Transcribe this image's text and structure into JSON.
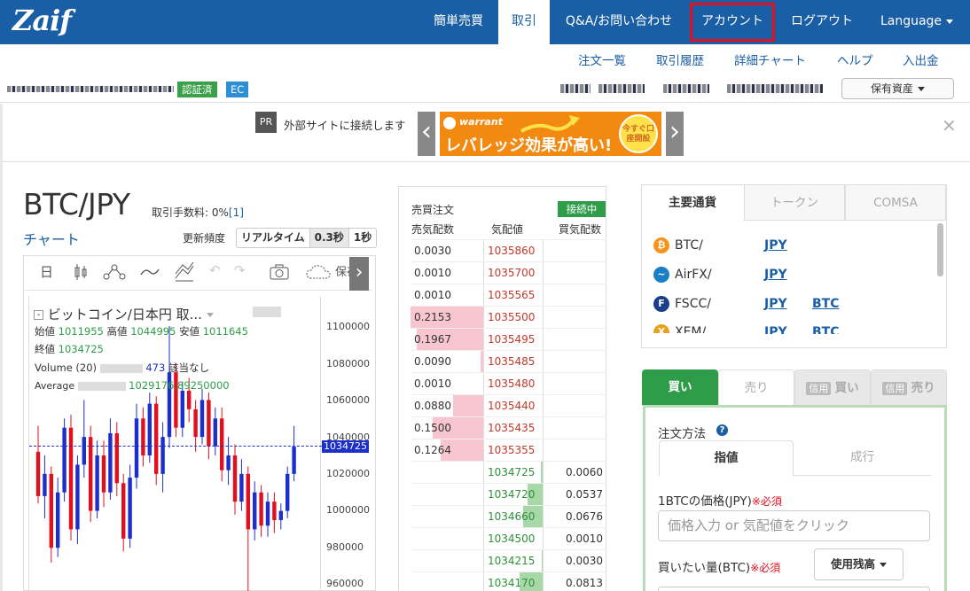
{
  "brand": {
    "logo_text": "Zaif"
  },
  "nav": {
    "items": [
      {
        "label": "簡単売買"
      },
      {
        "label": "取引"
      },
      {
        "label": "Q&A/お問い合わせ"
      },
      {
        "label": "アカウント"
      },
      {
        "label": "ログアウト"
      },
      {
        "label": "Language"
      }
    ],
    "active_index": 1,
    "highlighted_index": 3
  },
  "subnav": {
    "items": [
      "注文一覧",
      "取引履歴",
      "詳細チャート",
      "ヘルプ",
      "入出金"
    ]
  },
  "user": {
    "verified_badge": "認証済",
    "ec_badge": "EC",
    "assets_button": "保有資産"
  },
  "ad": {
    "pr_label": "PR",
    "notice": "外部サイトに接続します",
    "brand": "warrant",
    "headline": "レバレッジ効果が高い!",
    "cta": "今すぐ口座開設",
    "close": "×"
  },
  "pair": {
    "title": "BTC/JPY",
    "fee_label": "取引手数料: 0%",
    "fee_link": "[1]"
  },
  "chart_panel": {
    "chart_link": "チャート",
    "frequency_label": "更新頻度",
    "frequency_options": [
      "リアルタイム",
      "0.3秒",
      "1秒"
    ],
    "toolbar": {
      "day": "日",
      "save": "保存"
    },
    "legend_title": "ビットコイン/日本円 取...",
    "open_label": "始値",
    "open_value": "1011955",
    "high_label": "高値",
    "high_value": "1044995",
    "low_label": "安値",
    "low_value": "1011645",
    "close_label": "終値",
    "close_value": "1034725",
    "volume_label": "Volume (20)",
    "volume_value": "473",
    "volume_note": "該当なし",
    "average_label": "Average",
    "average_value": "1029176.89250000",
    "y_ticks": [
      "1100000",
      "1080000",
      "1060000",
      "1040000",
      "1020000",
      "1000000",
      "980000",
      "960000"
    ],
    "last_price": "1034725"
  },
  "orderbook": {
    "title": "売買注文",
    "status": "接続中",
    "headers": [
      "売気配数",
      "気配値",
      "買気配数"
    ],
    "asks": [
      {
        "qty": "0.0030",
        "price": "1035860",
        "fill": 0
      },
      {
        "qty": "0.0010",
        "price": "1035700",
        "fill": 0
      },
      {
        "qty": "0.0010",
        "price": "1035565",
        "fill": 0
      },
      {
        "qty": "0.2153",
        "price": "1035500",
        "fill": 1.0
      },
      {
        "qty": "0.1967",
        "price": "1035495",
        "fill": 0.91
      },
      {
        "qty": "0.0090",
        "price": "1035485",
        "fill": 0.04
      },
      {
        "qty": "0.0010",
        "price": "1035480",
        "fill": 0
      },
      {
        "qty": "0.0880",
        "price": "1035440",
        "fill": 0.41
      },
      {
        "qty": "0.1500",
        "price": "1035435",
        "fill": 0.7
      },
      {
        "qty": "0.1264",
        "price": "1035355",
        "fill": 0.59
      }
    ],
    "bids": [
      {
        "price": "1034725",
        "qty": "0.0060",
        "fill": 0.03
      },
      {
        "price": "1034720",
        "qty": "0.0537",
        "fill": 0.26
      },
      {
        "price": "1034660",
        "qty": "0.0676",
        "fill": 0.33
      },
      {
        "price": "1034500",
        "qty": "0.0010",
        "fill": 0
      },
      {
        "price": "1034215",
        "qty": "0.0030",
        "fill": 0.01
      },
      {
        "price": "1034170",
        "qty": "0.0813",
        "fill": 0.4
      }
    ]
  },
  "coins": {
    "tabs": [
      "主要通貨",
      "トークン",
      "COMSA"
    ],
    "rows": [
      {
        "name": "BTC/",
        "links": [
          "JPY"
        ],
        "color": "#f7931a",
        "glyph": "₿"
      },
      {
        "name": "AirFX/",
        "links": [
          "JPY"
        ],
        "color": "#1a7fc4",
        "glyph": "~"
      },
      {
        "name": "FSCC/",
        "links": [
          "JPY",
          "BTC"
        ],
        "color": "#1a3f8a",
        "glyph": "F"
      },
      {
        "name": "XEM/",
        "links": [
          "JPY",
          "BTC"
        ],
        "color": "#e8a020",
        "glyph": "X"
      }
    ]
  },
  "order_form": {
    "tabs": [
      "買い",
      "売り",
      "信用",
      "買い",
      "信用",
      "売り"
    ],
    "method_label": "注文方法",
    "help_icon": "?",
    "method_tabs": [
      "指値",
      "成行"
    ],
    "price_label": "1BTCの価格(JPY)",
    "required": "※必須",
    "price_placeholder": "価格入力 or 気配値をクリック",
    "qty_label": "買いたい量(BTC)",
    "use_balance": "使用残高"
  },
  "colors": {
    "brand_blue": "#1a5fa5",
    "buy_green": "#2f9c4a",
    "ask_red": "#c0392b",
    "bid_green": "#2f8f3a"
  }
}
